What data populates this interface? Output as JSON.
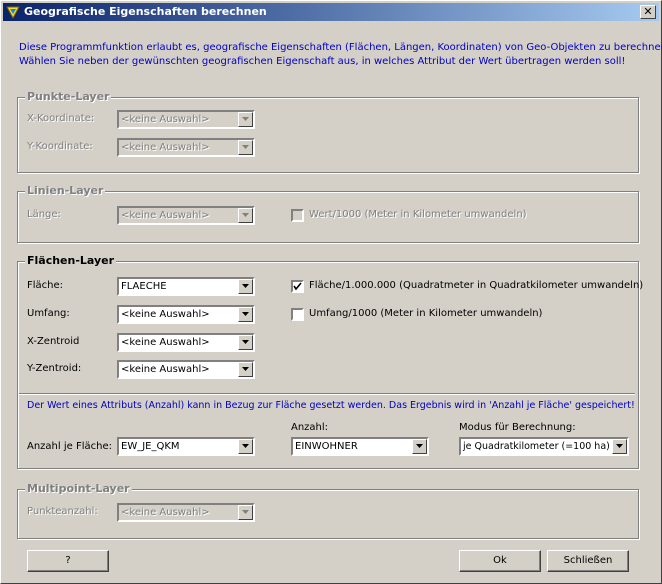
{
  "window": {
    "title": "Geografische Eigenschaften berechnen",
    "close_label": "✕"
  },
  "intro": {
    "line1": "Diese Programmfunktion erlaubt es, geografische Eigenschaften (Flächen, Längen, Koordinaten) von Geo-Objekten zu berechnen!",
    "line2": "Wählen Sie neben der gewünschten geografischen Eigenschaft aus, in welches Attribut der Wert übertragen werden soll!"
  },
  "punkte": {
    "legend": "Punkte-Layer",
    "x_label": "X-Koordinate:",
    "x_value": "<keine Auswahl>",
    "y_label": "Y-Koordinate:",
    "y_value": "<keine Auswahl>"
  },
  "linien": {
    "legend": "Linien-Layer",
    "laenge_label": "Länge:",
    "laenge_value": "<keine Auswahl>",
    "check_label": "Wert/1000 (Meter in Kilometer umwandeln)",
    "check_checked": false
  },
  "flaechen": {
    "legend": "Flächen-Layer",
    "flaeche_label": "Fläche:",
    "flaeche_value": "FLAECHE",
    "umfang_label": "Umfang:",
    "umfang_value": "<keine Auswahl>",
    "xz_label": "X-Zentroid",
    "xz_value": "<keine Auswahl>",
    "yz_label": "Y-Zentroid:",
    "yz_value": "<keine Auswahl>",
    "check_flaeche_label": "Fläche/1.000.000 (Quadratmeter in Quadratkilometer umwandeln)",
    "check_flaeche_checked": true,
    "check_umfang_label": "Umfang/1000 (Meter in Kilometer umwandeln)",
    "check_umfang_checked": false,
    "info": "Der Wert eines Attributs (Anzahl) kann in Bezug zur Fläche gesetzt werden. Das Ergebnis wird in 'Anzahl je Fläche' gespeichert!",
    "anzahl_je_label": "Anzahl je Fläche:",
    "anzahl_je_value": "EW_JE_QKM",
    "anzahl_label": "Anzahl:",
    "anzahl_value": "EINWOHNER",
    "modus_label": "Modus für Berechnung:",
    "modus_value": "je Quadratkilometer (=100 ha)"
  },
  "multipoint": {
    "legend": "Multipoint-Layer",
    "punkte_label": "Punkteanzahl:",
    "punkte_value": "<keine Auswahl>"
  },
  "buttons": {
    "help": "?",
    "ok": "Ok",
    "close": "Schließen"
  },
  "colors": {
    "title_start": "#0a246a",
    "title_end": "#a6caf0",
    "info_text": "#0000c0",
    "face": "#d4d0c8"
  }
}
